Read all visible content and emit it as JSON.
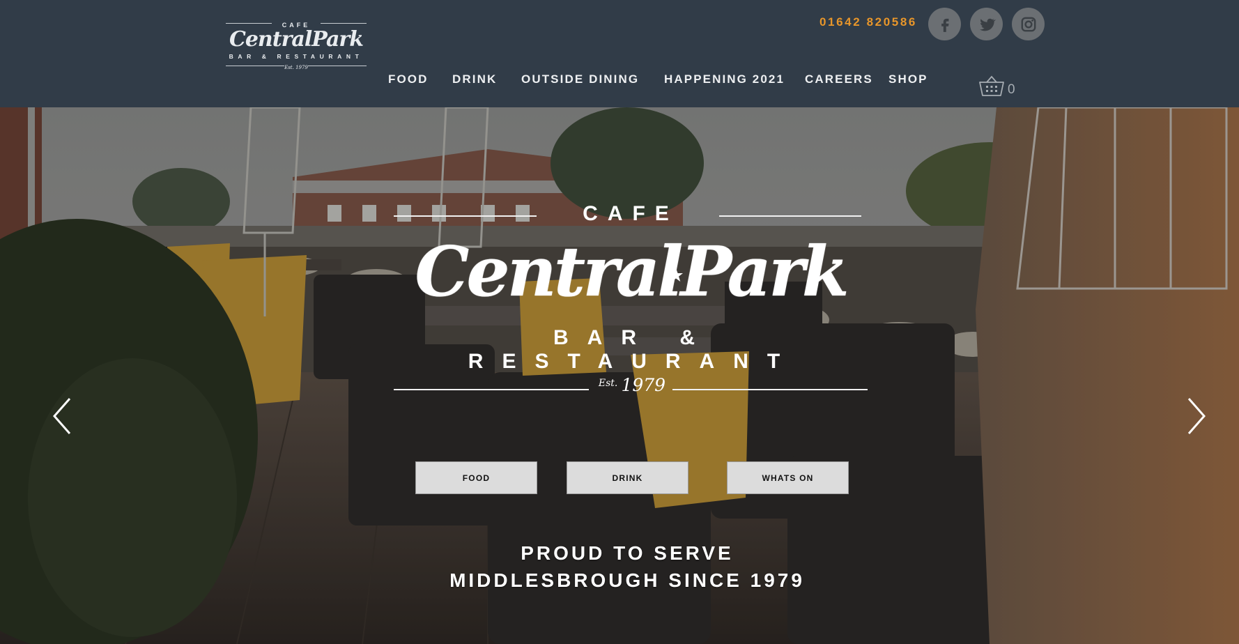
{
  "brand": {
    "cafe": "CAFE",
    "name": "CentralPark",
    "subtitle": "BAR & RESTAURANT",
    "est_prefix": "Est.",
    "est_year": "1979",
    "small_est": "Est. 1979"
  },
  "header": {
    "phone": "01642 820586",
    "social": [
      {
        "name": "facebook-icon"
      },
      {
        "name": "twitter-icon"
      },
      {
        "name": "instagram-icon"
      }
    ],
    "nav": [
      {
        "label": "FOOD"
      },
      {
        "label": "DRINK"
      },
      {
        "label": "OUTSIDE DINING"
      },
      {
        "label": "HAPPENING 2021"
      },
      {
        "label": "CAREERS"
      },
      {
        "label": "SHOP"
      }
    ],
    "cart_count": "0",
    "cart_icon": "basket-icon"
  },
  "hero": {
    "buttons": [
      {
        "label": "FOOD"
      },
      {
        "label": "DRINK"
      },
      {
        "label": "WHATS ON"
      }
    ],
    "tagline_line1": "PROUD TO SERVE",
    "tagline_line2": "MIDDLESBROUGH SINCE 1979",
    "prev_icon": "chevron-left-icon",
    "next_icon": "chevron-right-icon"
  },
  "colors": {
    "header_bg": "#313c48",
    "phone_accent": "#e8962a",
    "social_bg": "#6b6f73",
    "button_bg": "#dcdcdc"
  }
}
